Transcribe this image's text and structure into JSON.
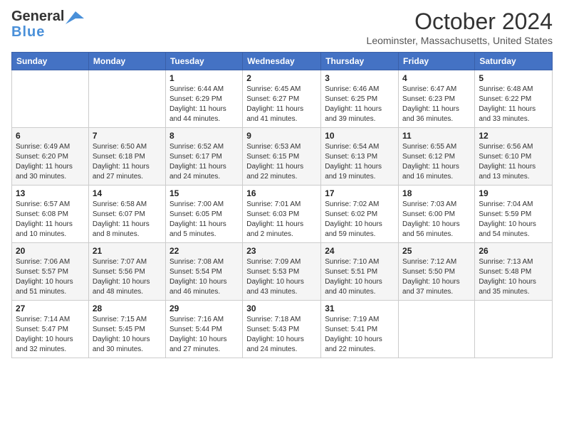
{
  "header": {
    "logo_line1": "General",
    "logo_line2": "Blue",
    "month_title": "October 2024",
    "location": "Leominster, Massachusetts, United States"
  },
  "days_of_week": [
    "Sunday",
    "Monday",
    "Tuesday",
    "Wednesday",
    "Thursday",
    "Friday",
    "Saturday"
  ],
  "weeks": [
    [
      {
        "day": "",
        "sunrise": "",
        "sunset": "",
        "daylight": ""
      },
      {
        "day": "",
        "sunrise": "",
        "sunset": "",
        "daylight": ""
      },
      {
        "day": "1",
        "sunrise": "Sunrise: 6:44 AM",
        "sunset": "Sunset: 6:29 PM",
        "daylight": "Daylight: 11 hours and 44 minutes."
      },
      {
        "day": "2",
        "sunrise": "Sunrise: 6:45 AM",
        "sunset": "Sunset: 6:27 PM",
        "daylight": "Daylight: 11 hours and 41 minutes."
      },
      {
        "day": "3",
        "sunrise": "Sunrise: 6:46 AM",
        "sunset": "Sunset: 6:25 PM",
        "daylight": "Daylight: 11 hours and 39 minutes."
      },
      {
        "day": "4",
        "sunrise": "Sunrise: 6:47 AM",
        "sunset": "Sunset: 6:23 PM",
        "daylight": "Daylight: 11 hours and 36 minutes."
      },
      {
        "day": "5",
        "sunrise": "Sunrise: 6:48 AM",
        "sunset": "Sunset: 6:22 PM",
        "daylight": "Daylight: 11 hours and 33 minutes."
      }
    ],
    [
      {
        "day": "6",
        "sunrise": "Sunrise: 6:49 AM",
        "sunset": "Sunset: 6:20 PM",
        "daylight": "Daylight: 11 hours and 30 minutes."
      },
      {
        "day": "7",
        "sunrise": "Sunrise: 6:50 AM",
        "sunset": "Sunset: 6:18 PM",
        "daylight": "Daylight: 11 hours and 27 minutes."
      },
      {
        "day": "8",
        "sunrise": "Sunrise: 6:52 AM",
        "sunset": "Sunset: 6:17 PM",
        "daylight": "Daylight: 11 hours and 24 minutes."
      },
      {
        "day": "9",
        "sunrise": "Sunrise: 6:53 AM",
        "sunset": "Sunset: 6:15 PM",
        "daylight": "Daylight: 11 hours and 22 minutes."
      },
      {
        "day": "10",
        "sunrise": "Sunrise: 6:54 AM",
        "sunset": "Sunset: 6:13 PM",
        "daylight": "Daylight: 11 hours and 19 minutes."
      },
      {
        "day": "11",
        "sunrise": "Sunrise: 6:55 AM",
        "sunset": "Sunset: 6:12 PM",
        "daylight": "Daylight: 11 hours and 16 minutes."
      },
      {
        "day": "12",
        "sunrise": "Sunrise: 6:56 AM",
        "sunset": "Sunset: 6:10 PM",
        "daylight": "Daylight: 11 hours and 13 minutes."
      }
    ],
    [
      {
        "day": "13",
        "sunrise": "Sunrise: 6:57 AM",
        "sunset": "Sunset: 6:08 PM",
        "daylight": "Daylight: 11 hours and 10 minutes."
      },
      {
        "day": "14",
        "sunrise": "Sunrise: 6:58 AM",
        "sunset": "Sunset: 6:07 PM",
        "daylight": "Daylight: 11 hours and 8 minutes."
      },
      {
        "day": "15",
        "sunrise": "Sunrise: 7:00 AM",
        "sunset": "Sunset: 6:05 PM",
        "daylight": "Daylight: 11 hours and 5 minutes."
      },
      {
        "day": "16",
        "sunrise": "Sunrise: 7:01 AM",
        "sunset": "Sunset: 6:03 PM",
        "daylight": "Daylight: 11 hours and 2 minutes."
      },
      {
        "day": "17",
        "sunrise": "Sunrise: 7:02 AM",
        "sunset": "Sunset: 6:02 PM",
        "daylight": "Daylight: 10 hours and 59 minutes."
      },
      {
        "day": "18",
        "sunrise": "Sunrise: 7:03 AM",
        "sunset": "Sunset: 6:00 PM",
        "daylight": "Daylight: 10 hours and 56 minutes."
      },
      {
        "day": "19",
        "sunrise": "Sunrise: 7:04 AM",
        "sunset": "Sunset: 5:59 PM",
        "daylight": "Daylight: 10 hours and 54 minutes."
      }
    ],
    [
      {
        "day": "20",
        "sunrise": "Sunrise: 7:06 AM",
        "sunset": "Sunset: 5:57 PM",
        "daylight": "Daylight: 10 hours and 51 minutes."
      },
      {
        "day": "21",
        "sunrise": "Sunrise: 7:07 AM",
        "sunset": "Sunset: 5:56 PM",
        "daylight": "Daylight: 10 hours and 48 minutes."
      },
      {
        "day": "22",
        "sunrise": "Sunrise: 7:08 AM",
        "sunset": "Sunset: 5:54 PM",
        "daylight": "Daylight: 10 hours and 46 minutes."
      },
      {
        "day": "23",
        "sunrise": "Sunrise: 7:09 AM",
        "sunset": "Sunset: 5:53 PM",
        "daylight": "Daylight: 10 hours and 43 minutes."
      },
      {
        "day": "24",
        "sunrise": "Sunrise: 7:10 AM",
        "sunset": "Sunset: 5:51 PM",
        "daylight": "Daylight: 10 hours and 40 minutes."
      },
      {
        "day": "25",
        "sunrise": "Sunrise: 7:12 AM",
        "sunset": "Sunset: 5:50 PM",
        "daylight": "Daylight: 10 hours and 37 minutes."
      },
      {
        "day": "26",
        "sunrise": "Sunrise: 7:13 AM",
        "sunset": "Sunset: 5:48 PM",
        "daylight": "Daylight: 10 hours and 35 minutes."
      }
    ],
    [
      {
        "day": "27",
        "sunrise": "Sunrise: 7:14 AM",
        "sunset": "Sunset: 5:47 PM",
        "daylight": "Daylight: 10 hours and 32 minutes."
      },
      {
        "day": "28",
        "sunrise": "Sunrise: 7:15 AM",
        "sunset": "Sunset: 5:45 PM",
        "daylight": "Daylight: 10 hours and 30 minutes."
      },
      {
        "day": "29",
        "sunrise": "Sunrise: 7:16 AM",
        "sunset": "Sunset: 5:44 PM",
        "daylight": "Daylight: 10 hours and 27 minutes."
      },
      {
        "day": "30",
        "sunrise": "Sunrise: 7:18 AM",
        "sunset": "Sunset: 5:43 PM",
        "daylight": "Daylight: 10 hours and 24 minutes."
      },
      {
        "day": "31",
        "sunrise": "Sunrise: 7:19 AM",
        "sunset": "Sunset: 5:41 PM",
        "daylight": "Daylight: 10 hours and 22 minutes."
      },
      {
        "day": "",
        "sunrise": "",
        "sunset": "",
        "daylight": ""
      },
      {
        "day": "",
        "sunrise": "",
        "sunset": "",
        "daylight": ""
      }
    ]
  ]
}
